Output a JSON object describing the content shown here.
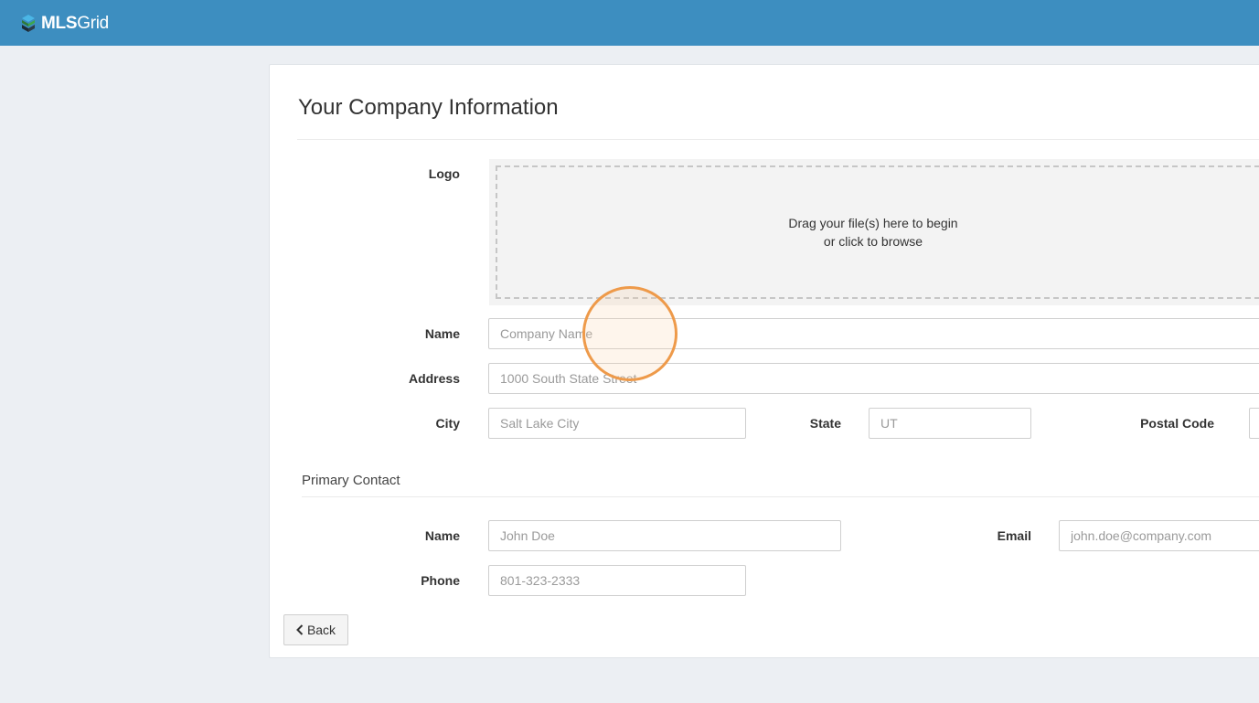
{
  "brand": {
    "bold": "MLS",
    "light": "Grid"
  },
  "page": {
    "title": "Your Company Information"
  },
  "logo_upload": {
    "label": "Logo",
    "line1": "Drag your file(s) here to begin",
    "line2": "or click to browse"
  },
  "company": {
    "name": {
      "label": "Name",
      "placeholder": "Company Name",
      "value": ""
    },
    "address": {
      "label": "Address",
      "placeholder": "1000 South State Street",
      "value": ""
    },
    "city": {
      "label": "City",
      "placeholder": "Salt Lake City",
      "value": ""
    },
    "state": {
      "label": "State",
      "placeholder": "UT",
      "value": ""
    },
    "postal_code": {
      "label": "Postal Code",
      "placeholder": "",
      "value": ""
    }
  },
  "primary_contact": {
    "title": "Primary Contact",
    "name": {
      "label": "Name",
      "placeholder": "John Doe",
      "value": ""
    },
    "email": {
      "label": "Email",
      "placeholder": "john.doe@company.com",
      "value": ""
    },
    "phone": {
      "label": "Phone",
      "placeholder": "801-323-2333",
      "value": ""
    }
  },
  "actions": {
    "back_label": "Back"
  },
  "colors": {
    "header": "#3d8ec0",
    "page_bg": "#eceff3",
    "cursor_ring": "#ee9a4a"
  },
  "icons": {
    "logo": "mlsgrid-cube-icon",
    "back": "chevron-left-icon"
  }
}
